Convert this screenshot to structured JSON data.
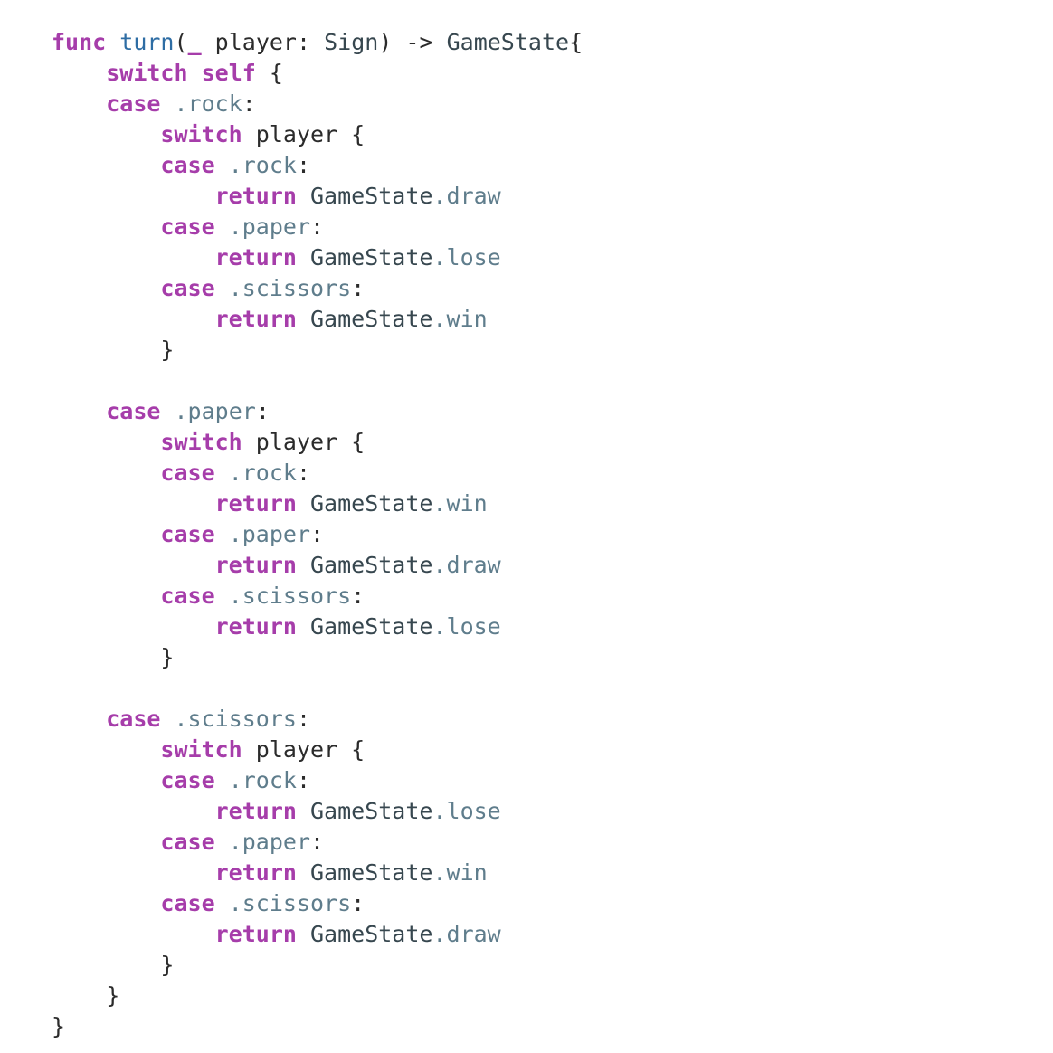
{
  "editor": {
    "language": "Swift",
    "background_color": "#ffffff",
    "font_size_px": 25,
    "line_height_px": 34,
    "indent_unit": "    "
  },
  "theme": {
    "keyword_color": "#a63daa",
    "function_name_color": "#2e6da4",
    "type_color": "#37474f",
    "member_color": "#5f7d8c",
    "plain_color": "#2b2b2b",
    "background_color": "#ffffff"
  },
  "code": {
    "lines": [
      {
        "id": "line-1",
        "indent": 0,
        "tokens": [
          {
            "t": "func",
            "c": "kw"
          },
          {
            "t": " ",
            "c": "pl"
          },
          {
            "t": "turn",
            "c": "fn"
          },
          {
            "t": "(",
            "c": "pl"
          },
          {
            "t": "_",
            "c": "kw"
          },
          {
            "t": " player: ",
            "c": "pl"
          },
          {
            "t": "Sign",
            "c": "type"
          },
          {
            "t": ") ",
            "c": "pl"
          },
          {
            "t": "->",
            "c": "pl"
          },
          {
            "t": " ",
            "c": "pl"
          },
          {
            "t": "GameState",
            "c": "type"
          },
          {
            "t": "{",
            "c": "pl"
          }
        ]
      },
      {
        "id": "line-2",
        "indent": 1,
        "tokens": [
          {
            "t": "switch",
            "c": "kw"
          },
          {
            "t": " ",
            "c": "pl"
          },
          {
            "t": "self",
            "c": "kw"
          },
          {
            "t": " {",
            "c": "pl"
          }
        ]
      },
      {
        "id": "line-3",
        "indent": 1,
        "tokens": [
          {
            "t": "case",
            "c": "kw"
          },
          {
            "t": " ",
            "c": "pl"
          },
          {
            "t": ".rock",
            "c": "mem"
          },
          {
            "t": ":",
            "c": "pl"
          }
        ]
      },
      {
        "id": "line-4",
        "indent": 2,
        "tokens": [
          {
            "t": "switch",
            "c": "kw"
          },
          {
            "t": " player {",
            "c": "pl"
          }
        ]
      },
      {
        "id": "line-5",
        "indent": 2,
        "tokens": [
          {
            "t": "case",
            "c": "kw"
          },
          {
            "t": " ",
            "c": "pl"
          },
          {
            "t": ".rock",
            "c": "mem"
          },
          {
            "t": ":",
            "c": "pl"
          }
        ]
      },
      {
        "id": "line-6",
        "indent": 3,
        "tokens": [
          {
            "t": "return",
            "c": "kw"
          },
          {
            "t": " ",
            "c": "pl"
          },
          {
            "t": "GameState",
            "c": "type"
          },
          {
            "t": ".draw",
            "c": "mem"
          }
        ]
      },
      {
        "id": "line-7",
        "indent": 2,
        "tokens": [
          {
            "t": "case",
            "c": "kw"
          },
          {
            "t": " ",
            "c": "pl"
          },
          {
            "t": ".paper",
            "c": "mem"
          },
          {
            "t": ":",
            "c": "pl"
          }
        ]
      },
      {
        "id": "line-8",
        "indent": 3,
        "tokens": [
          {
            "t": "return",
            "c": "kw"
          },
          {
            "t": " ",
            "c": "pl"
          },
          {
            "t": "GameState",
            "c": "type"
          },
          {
            "t": ".lose",
            "c": "mem"
          }
        ]
      },
      {
        "id": "line-9",
        "indent": 2,
        "tokens": [
          {
            "t": "case",
            "c": "kw"
          },
          {
            "t": " ",
            "c": "pl"
          },
          {
            "t": ".scissors",
            "c": "mem"
          },
          {
            "t": ":",
            "c": "pl"
          }
        ]
      },
      {
        "id": "line-10",
        "indent": 3,
        "tokens": [
          {
            "t": "return",
            "c": "kw"
          },
          {
            "t": " ",
            "c": "pl"
          },
          {
            "t": "GameState",
            "c": "type"
          },
          {
            "t": ".win",
            "c": "mem"
          }
        ]
      },
      {
        "id": "line-11",
        "indent": 2,
        "tokens": [
          {
            "t": "}",
            "c": "pl"
          }
        ]
      },
      {
        "id": "line-12",
        "indent": 0,
        "blank": true,
        "tokens": []
      },
      {
        "id": "line-13",
        "indent": 1,
        "tokens": [
          {
            "t": "case",
            "c": "kw"
          },
          {
            "t": " ",
            "c": "pl"
          },
          {
            "t": ".paper",
            "c": "mem"
          },
          {
            "t": ":",
            "c": "pl"
          }
        ]
      },
      {
        "id": "line-14",
        "indent": 2,
        "tokens": [
          {
            "t": "switch",
            "c": "kw"
          },
          {
            "t": " player {",
            "c": "pl"
          }
        ]
      },
      {
        "id": "line-15",
        "indent": 2,
        "tokens": [
          {
            "t": "case",
            "c": "kw"
          },
          {
            "t": " ",
            "c": "pl"
          },
          {
            "t": ".rock",
            "c": "mem"
          },
          {
            "t": ":",
            "c": "pl"
          }
        ]
      },
      {
        "id": "line-16",
        "indent": 3,
        "tokens": [
          {
            "t": "return",
            "c": "kw"
          },
          {
            "t": " ",
            "c": "pl"
          },
          {
            "t": "GameState",
            "c": "type"
          },
          {
            "t": ".win",
            "c": "mem"
          }
        ]
      },
      {
        "id": "line-17",
        "indent": 2,
        "tokens": [
          {
            "t": "case",
            "c": "kw"
          },
          {
            "t": " ",
            "c": "pl"
          },
          {
            "t": ".paper",
            "c": "mem"
          },
          {
            "t": ":",
            "c": "pl"
          }
        ]
      },
      {
        "id": "line-18",
        "indent": 3,
        "tokens": [
          {
            "t": "return",
            "c": "kw"
          },
          {
            "t": " ",
            "c": "pl"
          },
          {
            "t": "GameState",
            "c": "type"
          },
          {
            "t": ".draw",
            "c": "mem"
          }
        ]
      },
      {
        "id": "line-19",
        "indent": 2,
        "tokens": [
          {
            "t": "case",
            "c": "kw"
          },
          {
            "t": " ",
            "c": "pl"
          },
          {
            "t": ".scissors",
            "c": "mem"
          },
          {
            "t": ":",
            "c": "pl"
          }
        ]
      },
      {
        "id": "line-20",
        "indent": 3,
        "tokens": [
          {
            "t": "return",
            "c": "kw"
          },
          {
            "t": " ",
            "c": "pl"
          },
          {
            "t": "GameState",
            "c": "type"
          },
          {
            "t": ".lose",
            "c": "mem"
          }
        ]
      },
      {
        "id": "line-21",
        "indent": 2,
        "tokens": [
          {
            "t": "}",
            "c": "pl"
          }
        ]
      },
      {
        "id": "line-22",
        "indent": 0,
        "blank": true,
        "tokens": []
      },
      {
        "id": "line-23",
        "indent": 1,
        "tokens": [
          {
            "t": "case",
            "c": "kw"
          },
          {
            "t": " ",
            "c": "pl"
          },
          {
            "t": ".scissors",
            "c": "mem"
          },
          {
            "t": ":",
            "c": "pl"
          }
        ]
      },
      {
        "id": "line-24",
        "indent": 2,
        "tokens": [
          {
            "t": "switch",
            "c": "kw"
          },
          {
            "t": " player {",
            "c": "pl"
          }
        ]
      },
      {
        "id": "line-25",
        "indent": 2,
        "tokens": [
          {
            "t": "case",
            "c": "kw"
          },
          {
            "t": " ",
            "c": "pl"
          },
          {
            "t": ".rock",
            "c": "mem"
          },
          {
            "t": ":",
            "c": "pl"
          }
        ]
      },
      {
        "id": "line-26",
        "indent": 3,
        "tokens": [
          {
            "t": "return",
            "c": "kw"
          },
          {
            "t": " ",
            "c": "pl"
          },
          {
            "t": "GameState",
            "c": "type"
          },
          {
            "t": ".lose",
            "c": "mem"
          }
        ]
      },
      {
        "id": "line-27",
        "indent": 2,
        "tokens": [
          {
            "t": "case",
            "c": "kw"
          },
          {
            "t": " ",
            "c": "pl"
          },
          {
            "t": ".paper",
            "c": "mem"
          },
          {
            "t": ":",
            "c": "pl"
          }
        ]
      },
      {
        "id": "line-28",
        "indent": 3,
        "tokens": [
          {
            "t": "return",
            "c": "kw"
          },
          {
            "t": " ",
            "c": "pl"
          },
          {
            "t": "GameState",
            "c": "type"
          },
          {
            "t": ".win",
            "c": "mem"
          }
        ]
      },
      {
        "id": "line-29",
        "indent": 2,
        "tokens": [
          {
            "t": "case",
            "c": "kw"
          },
          {
            "t": " ",
            "c": "pl"
          },
          {
            "t": ".scissors",
            "c": "mem"
          },
          {
            "t": ":",
            "c": "pl"
          }
        ]
      },
      {
        "id": "line-30",
        "indent": 3,
        "tokens": [
          {
            "t": "return",
            "c": "kw"
          },
          {
            "t": " ",
            "c": "pl"
          },
          {
            "t": "GameState",
            "c": "type"
          },
          {
            "t": ".draw",
            "c": "mem"
          }
        ]
      },
      {
        "id": "line-31",
        "indent": 2,
        "tokens": [
          {
            "t": "}",
            "c": "pl"
          }
        ]
      },
      {
        "id": "line-32",
        "indent": 1,
        "tokens": [
          {
            "t": "}",
            "c": "pl"
          }
        ]
      },
      {
        "id": "line-33",
        "indent": 0,
        "tokens": [
          {
            "t": "}",
            "c": "pl"
          }
        ]
      }
    ]
  }
}
